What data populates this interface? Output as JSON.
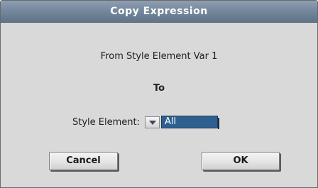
{
  "dialog": {
    "title": "Copy Expression",
    "from_text": "From Style Element Var 1",
    "to_text": "To",
    "style_element": {
      "label": "Style Element:",
      "selected_value": "All"
    },
    "buttons": {
      "cancel_label": "Cancel",
      "ok_label": "OK"
    }
  },
  "colors": {
    "titlebar": "#73869c",
    "dialog_background": "#d9d9d9",
    "selected_field": "#2f5f8f"
  },
  "icons": {
    "dropdown_arrow": "chevron-down-icon"
  }
}
